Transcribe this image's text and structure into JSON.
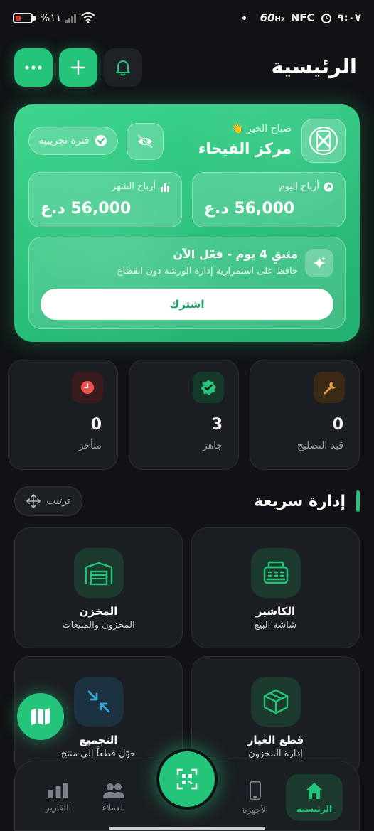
{
  "status_bar": {
    "battery_percent": "%١١",
    "time": "٩:٠٧",
    "network_speed": "60",
    "network_unit": "Hz",
    "nfc_label": "NFC"
  },
  "header": {
    "title": "الرئيسية"
  },
  "hero": {
    "greeting": "صباح الخير 👋",
    "center_name": "مركز الفيحاء",
    "trial_label": "فترة تجريبية",
    "today_profit_label": "أرباح اليوم",
    "today_profit_value": "56,000 د.ع",
    "month_profit_label": "أرباح الشهر",
    "month_profit_value": "56,000 د.ع",
    "subscription_title": "متبقٍ 4 يوم - فعّل الآن",
    "subscription_desc": "حافظ على استمرارية إدارة الورشة دون انقطاع",
    "subscribe_label": "اشترك"
  },
  "status_cards": [
    {
      "name": "in-repair",
      "value": "0",
      "label": "قيد التصليح",
      "color": "#f0a040"
    },
    {
      "name": "ready",
      "value": "3",
      "label": "جاهز",
      "color": "#25c47b"
    },
    {
      "name": "late",
      "value": "0",
      "label": "متأخر",
      "color": "#ef5350"
    }
  ],
  "quick_manage": {
    "title": "إدارة سريعة",
    "sort_label": "ترتيب",
    "tiles": [
      {
        "title": "الكاشير",
        "subtitle": "شاشة البيع",
        "icon": "cash-register-icon"
      },
      {
        "title": "المخزن",
        "subtitle": "المخزون والمبيعات",
        "icon": "warehouse-icon"
      },
      {
        "title": "قطع الغيار",
        "subtitle": "إدارة المخزون",
        "icon": "box-icon"
      },
      {
        "title": "التجميع",
        "subtitle": "حوّل قطعاً إلى منتج",
        "icon": "merge-icon"
      }
    ]
  },
  "bottom_nav": {
    "items": [
      {
        "label": "الرئيسية",
        "icon": "home-icon",
        "active": true
      },
      {
        "label": "الأجهزة",
        "icon": "phone-icon",
        "active": false
      },
      {
        "label": "العملاء",
        "icon": "users-icon",
        "active": false
      },
      {
        "label": "التقارير",
        "icon": "bar-chart-icon",
        "active": false
      }
    ]
  },
  "colors": {
    "accent": "#25c47b",
    "background": "#111316",
    "card": "#1b1e22"
  }
}
